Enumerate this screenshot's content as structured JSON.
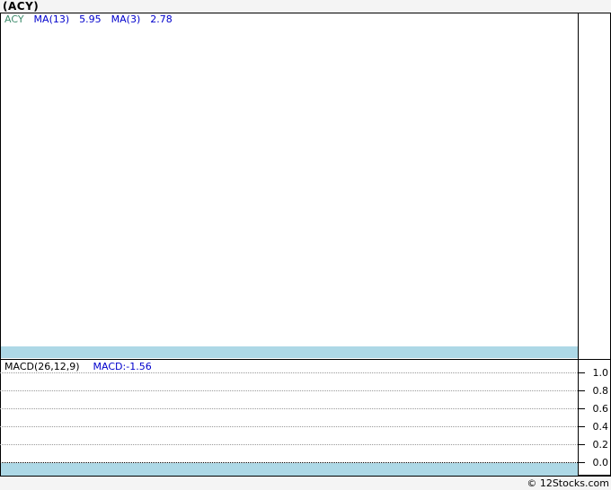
{
  "header": {
    "title": "(ACY)"
  },
  "main_panel": {
    "legend": {
      "symbol": "ACY",
      "ma13_label": "MA(13)",
      "ma13_value": "5.95",
      "ma3_label": "MA(3)",
      "ma3_value": "2.78"
    }
  },
  "macd_panel": {
    "legend": {
      "label": "MACD(26,12,9)",
      "value": "MACD:-1.56"
    },
    "y_axis": [
      "1.0",
      "0.8",
      "0.6",
      "0.4",
      "0.2",
      "0.0"
    ]
  },
  "footer": {
    "watermark": "© 12Stocks.com"
  },
  "colors": {
    "page_background": "#f4f4f4",
    "panel_background": "#ffffff",
    "border": "#000000",
    "band_blue": "#add8e6",
    "symbol_green": "#3d8b6b",
    "indicator_blue": "#0000cc",
    "gridline_gray": "#999999"
  },
  "chart_data": [
    {
      "type": "line",
      "panel": "price",
      "title": "(ACY)",
      "series": [
        {
          "name": "ACY",
          "values": []
        },
        {
          "name": "MA(13)",
          "values": [],
          "last_value": 5.95
        },
        {
          "name": "MA(3)",
          "values": [],
          "last_value": 2.78
        }
      ],
      "grid": false,
      "legend_position": "top-left",
      "note": "Price plot area renders empty; only legend values are visible"
    },
    {
      "type": "line",
      "panel": "indicator",
      "title": "MACD(26,12,9)",
      "series": [
        {
          "name": "MACD",
          "values": [],
          "last_value": -1.56
        }
      ],
      "ylim": [
        0.0,
        1.0
      ],
      "yticks": [
        1.0,
        0.8,
        0.6,
        0.4,
        0.2,
        0.0
      ],
      "grid": true,
      "legend_position": "top-left",
      "note": "Indicator plot area renders empty; dotted gridlines only, zero line dotted black"
    }
  ]
}
